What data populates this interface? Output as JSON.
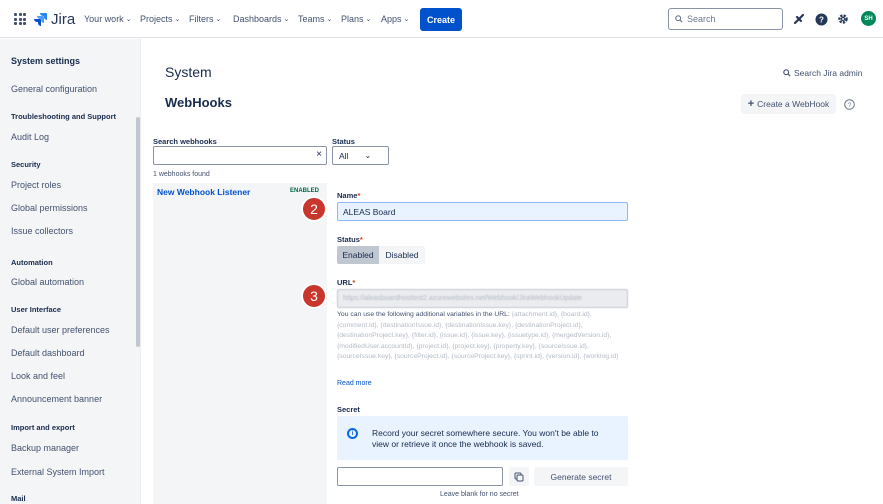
{
  "topnav": {
    "logo_text": "Jira",
    "items": [
      {
        "label": "Your work"
      },
      {
        "label": "Projects"
      },
      {
        "label": "Filters"
      },
      {
        "label": "Dashboards"
      },
      {
        "label": "Teams"
      },
      {
        "label": "Plans"
      },
      {
        "label": "Apps"
      }
    ],
    "create_label": "Create",
    "search_placeholder": "Search",
    "avatar_initials": "SH"
  },
  "sidebar": {
    "title": "System settings",
    "entries": [
      {
        "type": "link",
        "label": "General configuration"
      },
      {
        "type": "heading",
        "label": "Troubleshooting and Support"
      },
      {
        "type": "link",
        "label": "Audit Log"
      },
      {
        "type": "heading",
        "label": "Security"
      },
      {
        "type": "link",
        "label": "Project roles"
      },
      {
        "type": "link",
        "label": "Global permissions"
      },
      {
        "type": "link",
        "label": "Issue collectors"
      },
      {
        "type": "heading",
        "label": "Automation"
      },
      {
        "type": "link",
        "label": "Global automation"
      },
      {
        "type": "heading",
        "label": "User Interface"
      },
      {
        "type": "link",
        "label": "Default user preferences"
      },
      {
        "type": "link",
        "label": "Default dashboard"
      },
      {
        "type": "link",
        "label": "Look and feel"
      },
      {
        "type": "link",
        "label": "Announcement banner"
      },
      {
        "type": "heading",
        "label": "Import and export"
      },
      {
        "type": "link",
        "label": "Backup manager"
      },
      {
        "type": "link",
        "label": "External System Import"
      },
      {
        "type": "heading",
        "label": "Mail"
      }
    ]
  },
  "page": {
    "title": "System",
    "subtitle": "WebHooks",
    "search_admin_label": "Search Jira admin",
    "create_webhook_label": "Create a WebHook"
  },
  "filters": {
    "search_label": "Search webhooks",
    "search_value": "",
    "status_label": "Status",
    "status_value": "All",
    "found_text": "1 webhooks found"
  },
  "webhooks": [
    {
      "name": "New Webhook Listener",
      "status": "ENABLED"
    }
  ],
  "form": {
    "name_label": "Name",
    "name_value": "ALEAS Board",
    "status_label": "Status",
    "status_enabled": "Enabled",
    "status_disabled": "Disabled",
    "url_label": "URL",
    "url_value": "https://aleasboardhosttest2.azurewebsites.net/Webhook/JiraWebhookUpdate",
    "help_intro": "You can use the following additional variables in the URL:",
    "help_vars": "{attachment.id}, {board.id}, {comment.id}, {destinationIssue.id}, {destinationIssue.key}, {destinationProject.id}, {destinationProject.key}, {filter.id}, {issue.id}, {issue.key}, {issuetype.id}, {mergedVersion.id}, {modifiedUser.accountId}, {project.id}, {project.key}, {property.key}, {sourceIssue.id}, {sourceIssue.key}, {sourceProject.id}, {sourceProject.key}, {sprint.id}, {version.id}, {worklog.id}",
    "read_more": "Read more",
    "secret_label": "Secret",
    "secret_message": "Record your secret somewhere secure. You won't be able to view or retrieve it once the webhook is saved.",
    "secret_value": "",
    "generate_label": "Generate secret",
    "secret_hint": "Leave blank for no secret"
  },
  "annotations": {
    "step_name": "2",
    "step_url": "3"
  },
  "colors": {
    "primary": "#0052cc",
    "enabled_badge": "#006644",
    "step_marker": "#c9372c",
    "avatar": "#00875a"
  }
}
